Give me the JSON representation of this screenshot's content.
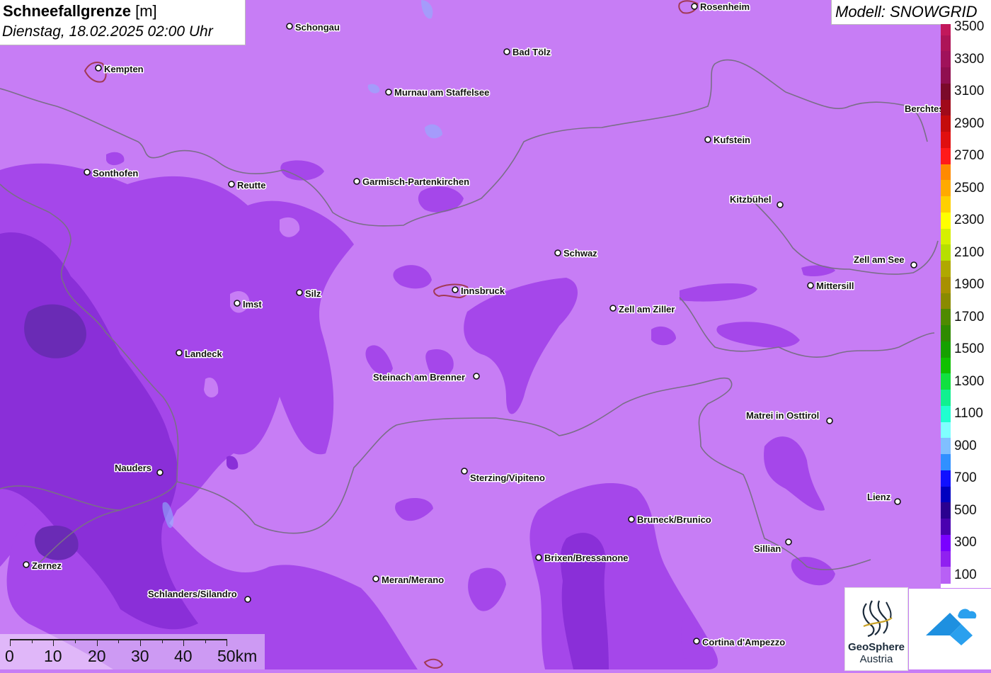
{
  "title": {
    "main": "Schneefallgrenze",
    "unit": "[m]",
    "datetime": "Dienstag, 18.02.2025 02:00 Uhr"
  },
  "model": {
    "label": "Modell: SNOWGRID"
  },
  "colors": {
    "background": "#c77df5",
    "mid_purple": "#a547ea",
    "dark_purple": "#8a2fd8",
    "darkest": "#6a2bb5",
    "border": "#7a6e88"
  },
  "legend": {
    "levels": [
      {
        "label": "3500",
        "color": "#c2185b"
      },
      {
        "label": "",
        "color": "#ad1457"
      },
      {
        "label": "3300",
        "color": "#a0125a"
      },
      {
        "label": "",
        "color": "#900f50"
      },
      {
        "label": "3100",
        "color": "#7b0a2a"
      },
      {
        "label": "",
        "color": "#a00a1a"
      },
      {
        "label": "2900",
        "color": "#c40c0c"
      },
      {
        "label": "",
        "color": "#e00f0f"
      },
      {
        "label": "2700",
        "color": "#ff1a1a"
      },
      {
        "label": "",
        "color": "#ff8a00"
      },
      {
        "label": "2500",
        "color": "#ffaa00"
      },
      {
        "label": "",
        "color": "#ffd000"
      },
      {
        "label": "2300",
        "color": "#ffff00"
      },
      {
        "label": "",
        "color": "#d6f000"
      },
      {
        "label": "2100",
        "color": "#b7df00"
      },
      {
        "label": "",
        "color": "#b0a800"
      },
      {
        "label": "1900",
        "color": "#a89000"
      },
      {
        "label": "",
        "color": "#8a8a00"
      },
      {
        "label": "1700",
        "color": "#4f8a00"
      },
      {
        "label": "",
        "color": "#2f8a00"
      },
      {
        "label": "1500",
        "color": "#16a000"
      },
      {
        "label": "",
        "color": "#10c000"
      },
      {
        "label": "1300",
        "color": "#10e040"
      },
      {
        "label": "",
        "color": "#10f090"
      },
      {
        "label": "1100",
        "color": "#20ffd0"
      },
      {
        "label": "",
        "color": "#80ffff"
      },
      {
        "label": "900",
        "color": "#80bfff"
      },
      {
        "label": "",
        "color": "#3090ff"
      },
      {
        "label": "700",
        "color": "#1010ff"
      },
      {
        "label": "",
        "color": "#0000c0"
      },
      {
        "label": "500",
        "color": "#2a0090"
      },
      {
        "label": "",
        "color": "#4a00b0"
      },
      {
        "label": "300",
        "color": "#7a00ff"
      },
      {
        "label": "",
        "color": "#9020f0"
      },
      {
        "label": "100",
        "color": "#b860f5"
      }
    ]
  },
  "cities": [
    {
      "name": "Rosenheim"
    },
    {
      "name": "Schongau"
    },
    {
      "name": "Bad Tölz"
    },
    {
      "name": "Kempten"
    },
    {
      "name": "Murnau am Staffelsee"
    },
    {
      "name": "Berchtesgaden"
    },
    {
      "name": "Kufstein"
    },
    {
      "name": "Sonthofen"
    },
    {
      "name": "Reutte"
    },
    {
      "name": "Garmisch-Partenkirchen"
    },
    {
      "name": "Kitzbühel"
    },
    {
      "name": "Schwaz"
    },
    {
      "name": "Zell am See"
    },
    {
      "name": "Mittersill"
    },
    {
      "name": "Innsbruck"
    },
    {
      "name": "Silz"
    },
    {
      "name": "Imst"
    },
    {
      "name": "Zell am Ziller"
    },
    {
      "name": "Landeck"
    },
    {
      "name": "Steinach am Brenner"
    },
    {
      "name": "Matrei in Osttirol"
    },
    {
      "name": "Nauders"
    },
    {
      "name": "Sterzing/Vipiteno"
    },
    {
      "name": "Lienz"
    },
    {
      "name": "Bruneck/Brunico"
    },
    {
      "name": "Sillian"
    },
    {
      "name": "Brixen/Bressanone"
    },
    {
      "name": "Zernez"
    },
    {
      "name": "Meran/Merano"
    },
    {
      "name": "Schlanders/Silandro"
    },
    {
      "name": "Cortina d'Ampezzo"
    }
  ],
  "scale": {
    "labels": [
      "0",
      "10",
      "20",
      "30",
      "40",
      "50km"
    ]
  },
  "logos": {
    "geosphere_name": "GeoSphere",
    "geosphere_sub": "Austria"
  }
}
